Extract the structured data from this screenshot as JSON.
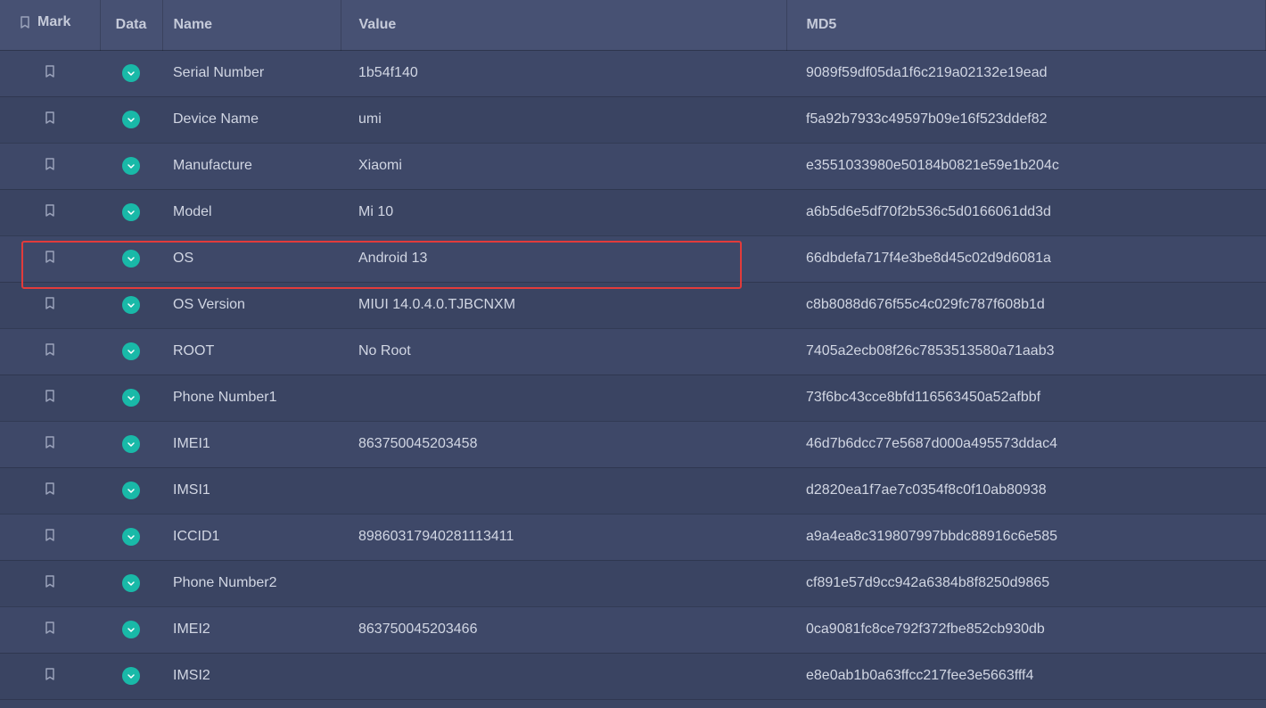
{
  "headers": {
    "mark": "Mark",
    "data": "Data",
    "name": "Name",
    "value": "Value",
    "md5": "MD5"
  },
  "icons": {
    "bookmark": "bookmark-icon",
    "check": "checkmark-down-icon"
  },
  "highlighted_row_index": 4,
  "rows": [
    {
      "name": "Serial Number",
      "value": "1b54f140",
      "md5": "9089f59df05da1f6c219a02132e19ead"
    },
    {
      "name": "Device Name",
      "value": "umi",
      "md5": "f5a92b7933c49597b09e16f523ddef82"
    },
    {
      "name": "Manufacture",
      "value": "Xiaomi",
      "md5": "e3551033980e50184b0821e59e1b204c"
    },
    {
      "name": "Model",
      "value": "Mi 10",
      "md5": "a6b5d6e5df70f2b536c5d0166061dd3d"
    },
    {
      "name": "OS",
      "value": "Android 13",
      "md5": "66dbdefa717f4e3be8d45c02d9d6081a"
    },
    {
      "name": "OS Version",
      "value": "MIUI 14.0.4.0.TJBCNXM",
      "md5": "c8b8088d676f55c4c029fc787f608b1d"
    },
    {
      "name": "ROOT",
      "value": "No Root",
      "md5": "7405a2ecb08f26c7853513580a71aab3"
    },
    {
      "name": "Phone Number1",
      "value": "",
      "md5": "73f6bc43cce8bfd116563450a52afbbf"
    },
    {
      "name": "IMEI1",
      "value": "863750045203458",
      "md5": "46d7b6dcc77e5687d000a495573ddac4"
    },
    {
      "name": "IMSI1",
      "value": "",
      "md5": "d2820ea1f7ae7c0354f8c0f10ab80938"
    },
    {
      "name": "ICCID1",
      "value": "89860317940281113411",
      "md5": "a9a4ea8c319807997bbdc88916c6e585"
    },
    {
      "name": "Phone Number2",
      "value": "",
      "md5": "cf891e57d9cc942a6384b8f8250d9865"
    },
    {
      "name": "IMEI2",
      "value": "863750045203466",
      "md5": "0ca9081fc8ce792f372fbe852cb930db"
    },
    {
      "name": "IMSI2",
      "value": "",
      "md5": "e8e0ab1b0a63ffcc217fee3e5663fff4"
    }
  ]
}
